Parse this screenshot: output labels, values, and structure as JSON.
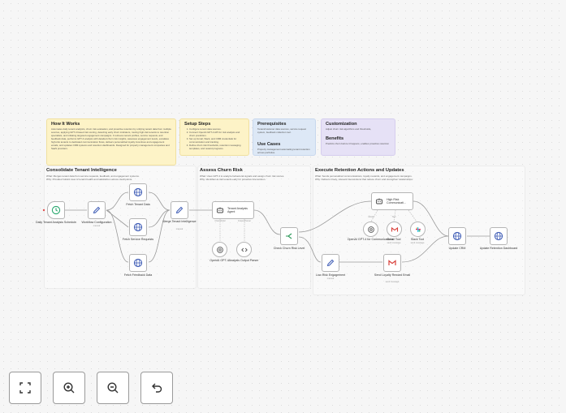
{
  "notes": {
    "how": {
      "title": "How It Works",
      "text": "Automates daily tenant analytics, churn risk evaluation, and proactive retention by unifying tenant data from multiple sources, applying GPT-4 based risk scoring, detecting early churn indicators, routing high-risk tenants to retention specialists, and initiating targeted engagement campaigns. It retrieves tenant profiles, service requests, and feedback data, performs GPT-4 analysis with detailed churn risk insights, assesses engagement levels, escalates high-risk tenants to dedicated communication flows, delivers personalized loyalty incentives and engagement emails, and updates CRM systems and retention dashboards. Designed for property management companies and SaaS providers."
    },
    "setup": {
      "title": "Setup Steps",
      "steps": [
        "Configure tenant data sources.",
        "Connect OpenAI GPT-4 API for risk analysis and churn prediction.",
        "Set up Gmail, Slack, and CRM credentials for communication and tracking.",
        "Define churn risk thresholds, retention messaging templates, and reward programs."
      ]
    },
    "prereq": {
      "title": "Prerequisites",
      "text": "Tenant/customer data sources, service request system, feedback collection tool.",
      "title2": "Use Cases",
      "text2": "Property management automating tenant retention across portfolios."
    },
    "custom": {
      "title": "Customization",
      "text": "Adjust churn risk algorithms and thresholds,",
      "title2": "Benefits",
      "text2": "Predicts churn before it happens, enables proactive retention"
    }
  },
  "sections": {
    "consolidate": {
      "title": "Consolidate Tenant Intelligence",
      "desc1": "What: Merges tenant data from service requests, feedback, and engagement systems.",
      "desc2": "Why: Provides holistic view of tenant health and satisfaction across touchpoints."
    },
    "assess": {
      "title": "Assess Churn Risk",
      "desc1": "What: Uses GPT-4 to analyze behavioral signals and assign churn risk scores.",
      "desc2": "Why: Identifies at-risk tenants early for proactive intervention."
    },
    "execute": {
      "title": "Execute Retention Actions and Updates",
      "desc1": "What: Sends personalized communications, loyalty rewards, and engagement campaigns.",
      "desc2": "Why: Delivers timely, relevant interventions that reduce churn and strengthen relationships."
    }
  },
  "nodes": {
    "schedule": "Daily Tenant Analysis Schedule",
    "workflow_config": "Workflow Configuration",
    "workflow_config_sub": "manual",
    "fetch_tenant": "Fetch Tenant Data",
    "fetch_service": "Fetch Service Requests",
    "fetch_feedback": "Fetch Feedback Data",
    "merge": "Merge Tenant Intelligence",
    "merge_sub": "manual",
    "agent": "Tenant Analysis Agent",
    "openai1": "OpenAI GPT-4",
    "parser": "Analysis Output Parser",
    "check": "Check Churn Risk Level",
    "highrisk": "High Risk Communicati...",
    "openai2": "OpenAI GPT-4 for Communications",
    "gmail_tool": "Gmail Tool",
    "gmail_tool_sub": "send message",
    "slack_tool": "Slack Tool",
    "slack_tool_sub": "send message",
    "lowrisk": "Low-Risk Engagement",
    "lowrisk_sub": "manual",
    "send_email": "Send Loyalty Reward Email",
    "send_email_sub": "send message",
    "update_crm": "Update CRM",
    "update_dash": "Update Retention Dashboard"
  },
  "ports": {
    "chat_model": "Chat Model",
    "output_parser": "Output Parser",
    "model": "Model",
    "tool": "Tool"
  },
  "controls": {
    "fit": "fit-view",
    "zoom_in": "zoom-in",
    "zoom_out": "zoom-out",
    "undo": "undo"
  },
  "colors": {
    "accent_trigger": "#2ba86f",
    "node_icon_blue": "#3d5bb5",
    "if_green": "#2f9a5b",
    "gmail_red": "#d8403a"
  }
}
